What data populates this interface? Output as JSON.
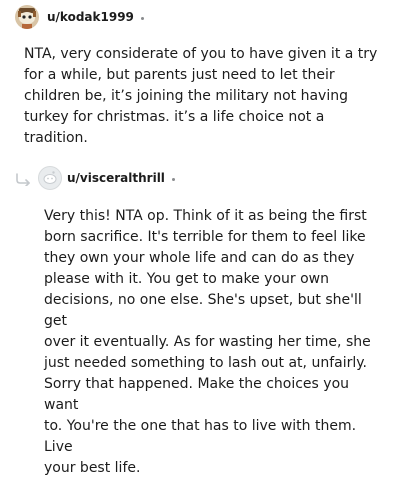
{
  "comments": [
    {
      "username": "u/kodak1999",
      "avatar_icon": "snoo-avatar-icon",
      "body": "NTA, very considerate of you to have given it a try\nfor a while, but parents just need to let their\nchildren be, it’s joining the military not having\nturkey for christmas. it’s a life choice not a tradition."
    },
    {
      "username": "u/visceralthrill",
      "avatar_icon": "default-avatar-icon",
      "reply_icon": "reply-arrow-icon",
      "body": "Very this! NTA op. Think of it as being the first\nborn sacrifice. It's terrible for them to feel like\nthey own your whole life and can do as they\nplease with it. You get to make your own\ndecisions, no one else. She's upset, but she'll get\nover it eventually. As for wasting her time, she\njust needed something to lash out at, unfairly.\nSorry that happened. Make the choices you want\nto. You're the one that has to live with them. Live\nyour best life."
    }
  ],
  "colors": {
    "text": "#1c1c1c",
    "meta_dot": "#8a8c8e",
    "reply_line": "#c4c8cc"
  }
}
